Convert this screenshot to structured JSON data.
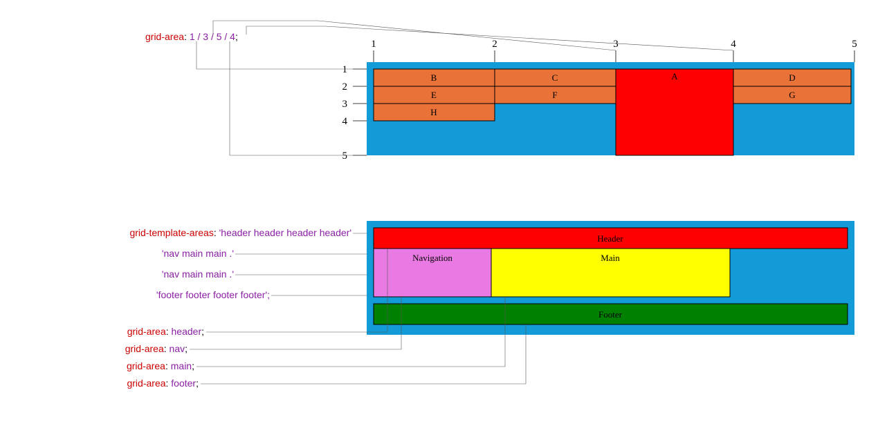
{
  "diagram1": {
    "code": {
      "prop": "grid-area",
      "value": "1 / 3 / 5 / 4",
      "suffix": ";"
    },
    "cols": [
      "1",
      "2",
      "3",
      "4",
      "5"
    ],
    "rows": [
      "1",
      "2",
      "3",
      "4",
      "5"
    ],
    "bigCell": "A",
    "cells": {
      "b": "B",
      "c": "C",
      "d": "D",
      "e": "E",
      "f": "F",
      "g": "G",
      "h": "H"
    }
  },
  "diagram2": {
    "templateProp": "grid-template-areas",
    "templateLines": [
      "'header header header header'",
      "'nav main main .'",
      "'nav main main .'",
      "'footer footer footer footer';"
    ],
    "areaProps": [
      {
        "prop": "grid-area",
        "value": "header",
        "suffix": ";"
      },
      {
        "prop": "grid-area",
        "value": "nav",
        "suffix": ";"
      },
      {
        "prop": "grid-area",
        "value": "main",
        "suffix": ";"
      },
      {
        "prop": "grid-area",
        "value": "footer",
        "suffix": ";"
      }
    ],
    "labels": {
      "header": "Header",
      "nav": "Navigation",
      "main": "Main",
      "footer": "Footer"
    }
  }
}
